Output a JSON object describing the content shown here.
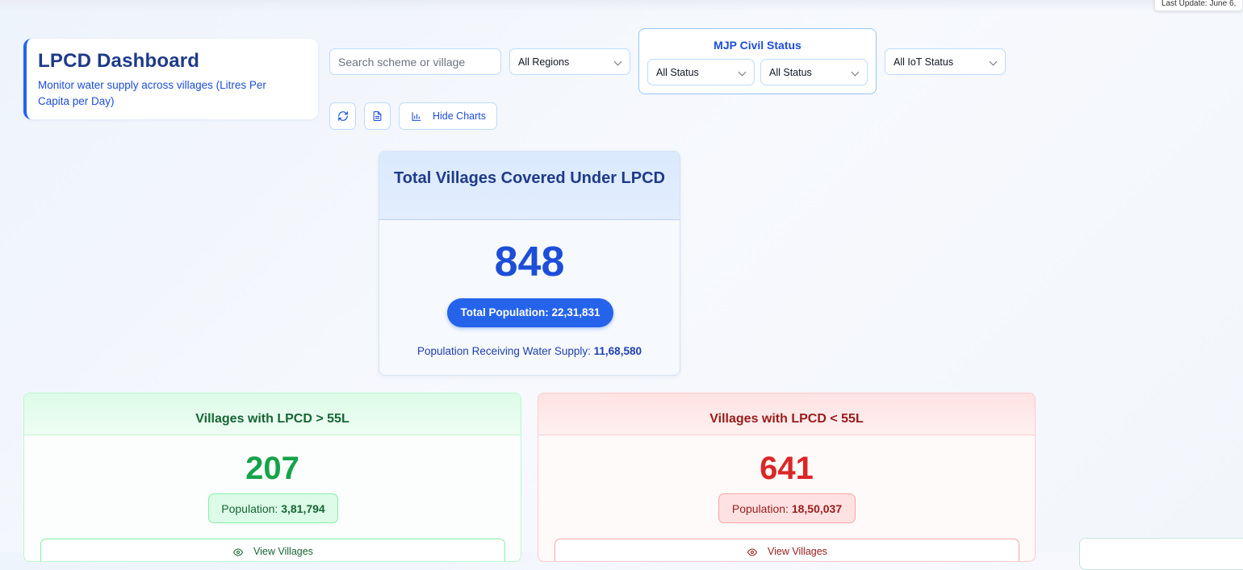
{
  "header": {
    "last_update": "Last Update: June 6,",
    "title": "LPCD Dashboard",
    "subtitle": "Monitor water supply across villages (Litres Per Capita per Day)"
  },
  "filters": {
    "search_placeholder": "Search scheme or village",
    "region": "All Regions",
    "mjp_label": "MJP Civil Status",
    "mjp_status_1": "All Status",
    "mjp_status_2": "All Status",
    "iot_status": "All IoT Status"
  },
  "toolbar": {
    "refresh_icon": "refresh-icon",
    "export_icon": "document-icon",
    "hide_charts_icon": "bar-chart-icon",
    "hide_charts_label": "Hide Charts"
  },
  "summary": {
    "title": "Total Villages Covered Under LPCD",
    "total_villages": "848",
    "total_population_label": "Total Population:",
    "total_population": "22,31,831",
    "supply_label": "Population Receiving Water Supply:",
    "supply_value": "11,68,580"
  },
  "above_55": {
    "title": "Villages with LPCD > 55L",
    "count": "207",
    "population_label": "Population:",
    "population": "3,81,794",
    "view_label": "View Villages",
    "color": "#16a34a"
  },
  "below_55": {
    "title": "Villages with LPCD < 55L",
    "count": "641",
    "population_label": "Population:",
    "population": "18,50,037",
    "view_label": "View Villages",
    "color": "#dc2626"
  }
}
